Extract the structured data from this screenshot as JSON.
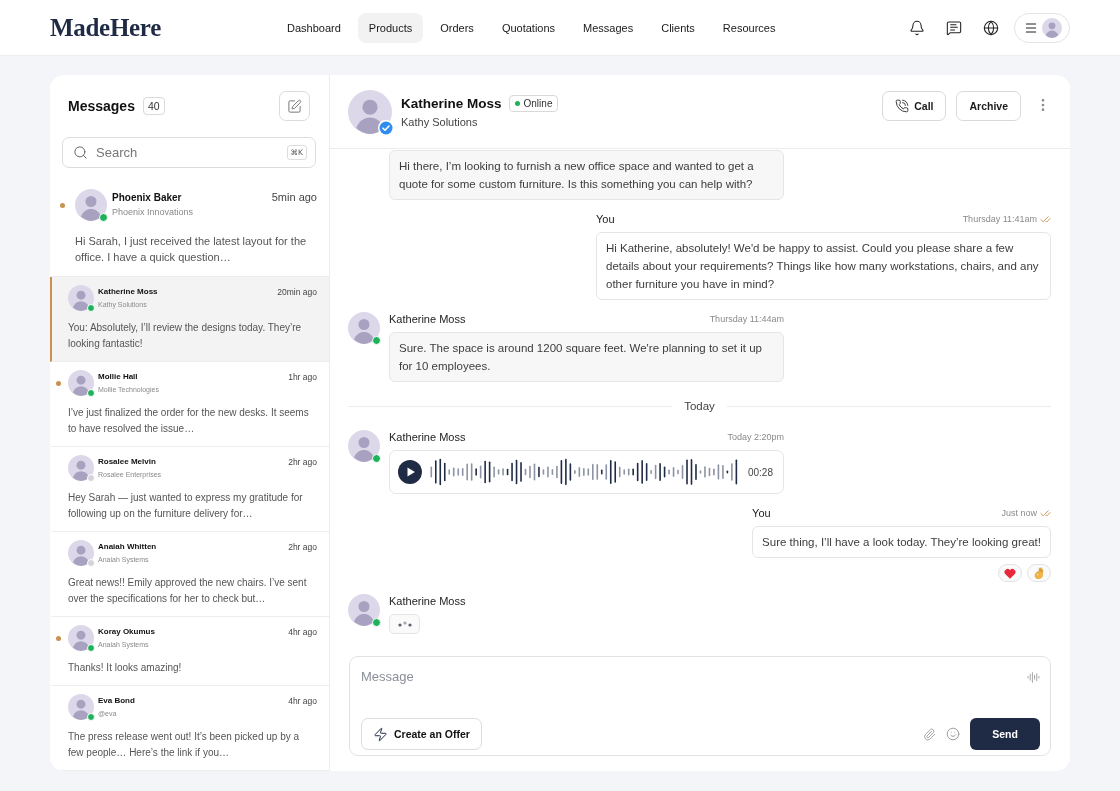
{
  "header": {
    "logo": "MadeHere",
    "nav": [
      {
        "label": "Dashboard",
        "selected": false
      },
      {
        "label": "Products",
        "selected": true
      },
      {
        "label": "Orders",
        "selected": false
      },
      {
        "label": "Quotations",
        "selected": false
      },
      {
        "label": "Messages",
        "selected": false
      },
      {
        "label": "Clients",
        "selected": false
      },
      {
        "label": "Resources",
        "selected": false
      }
    ]
  },
  "inbox": {
    "title": "Messages",
    "count": "40",
    "search": {
      "placeholder": "Search",
      "shortcut": "⌘K"
    },
    "conversations": [
      {
        "name": "Phoenix Baker",
        "company": "Phoenix Innovations",
        "time": "5min ago",
        "preview": "Hi Sarah, I just received the latest layout for the office. I have a quick question…",
        "unread": true,
        "online": true,
        "selected": false
      },
      {
        "name": "Katherine Moss",
        "company": "Kathy Solutions",
        "time": "20min ago",
        "preview": "You: Absolutely, I’ll review the designs today. They’re looking fantastic!",
        "unread": false,
        "online": true,
        "selected": true
      },
      {
        "name": "Mollie Hall",
        "company": "Mollie Technologies",
        "time": "1hr ago",
        "preview": "I’ve just finalized the order for the new desks. It seems to have resolved the issue…",
        "unread": true,
        "online": true,
        "selected": false
      },
      {
        "name": "Rosalee Melvin",
        "company": "Rosalee Enterprises",
        "time": "2hr ago",
        "preview": "Hey Sarah — just wanted to express my gratitude for following up on the furniture delivery for…",
        "unread": false,
        "online": false,
        "selected": false
      },
      {
        "name": "Anaiah Whitten",
        "company": "Anaiah Systems",
        "time": "2hr ago",
        "preview": "Great news!! Emily approved the new chairs. I’ve sent over the specifications for her to check but…",
        "unread": false,
        "online": false,
        "selected": false
      },
      {
        "name": "Koray Okumus",
        "company": "Anaiah Systems",
        "time": "4hr ago",
        "preview": "Thanks! It looks amazing!",
        "unread": true,
        "online": true,
        "selected": false
      },
      {
        "name": "Eva Bond",
        "company": "@eva",
        "time": "4hr ago",
        "preview": "The press release went out! It’s been picked up by a few people… Here’s the link if you…",
        "unread": false,
        "online": true,
        "selected": false
      }
    ]
  },
  "chat": {
    "contact": {
      "name": "Katherine Moss",
      "status": "Online",
      "company": "Kathy Solutions",
      "verified": true
    },
    "actions": [
      {
        "label": "Call",
        "kind": "call"
      },
      {
        "label": "Archive",
        "kind": "plain"
      }
    ],
    "messages": [
      {
        "kind": "text",
        "outgoing": false,
        "text": "Hi there, I’m looking to furnish a new office space and wanted to get a quote for some custom furniture. Is this something you can help with?"
      },
      {
        "kind": "text",
        "outgoing": true,
        "sender": "You",
        "time": "Thursday 11:41am",
        "read": true,
        "text": "Hi Katherine, absolutely! We'd be happy to assist. Could you please share a few details about your requirements? Things like how many workstations, chairs, and any other furniture you have in mind?"
      },
      {
        "kind": "text",
        "outgoing": false,
        "sender": "Katherine Moss",
        "time": "Thursday 11:44am",
        "online": true,
        "text": "Sure. The space is around 1200 square feet. We're planning to set it up for 10 employees."
      },
      {
        "kind": "divider",
        "label": "Today"
      },
      {
        "kind": "voice",
        "outgoing": false,
        "sender": "Katherine Moss",
        "time": "Today 2:20pm",
        "online": true,
        "duration": "00:28"
      },
      {
        "kind": "text",
        "outgoing": true,
        "sender": "You",
        "time": "Just now",
        "read": true,
        "text": "Sure thing, I’ll have a look today. They’re looking great!",
        "reactions": [
          {
            "kind": "heart"
          },
          {
            "kind": "ok_hand"
          }
        ]
      },
      {
        "kind": "typing",
        "outgoing": false,
        "sender": "Katherine Moss",
        "online": true
      }
    ],
    "composer": {
      "placeholder": "Message",
      "offer_button": "Create an Offer",
      "send_button": "Send"
    }
  }
}
